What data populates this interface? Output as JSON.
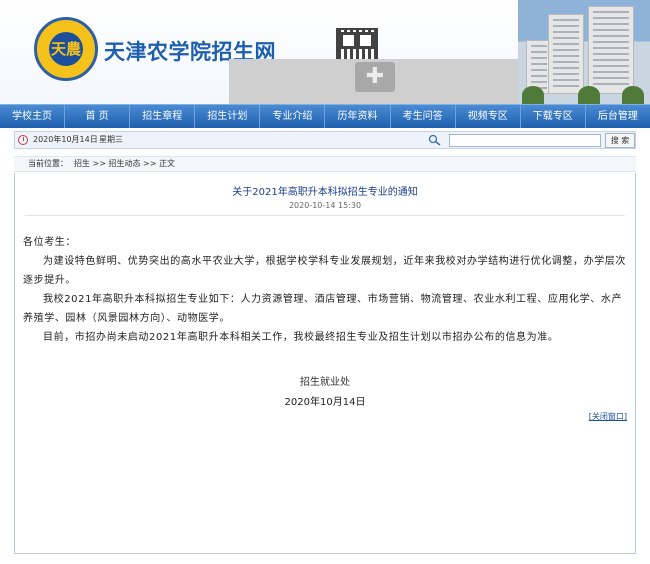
{
  "header": {
    "logo_text": "天農",
    "site_title": "天津农学院招生网"
  },
  "nav": {
    "items": [
      {
        "label": "学校主页"
      },
      {
        "label": "首 页"
      },
      {
        "label": "招生章程"
      },
      {
        "label": "招生计划"
      },
      {
        "label": "专业介绍"
      },
      {
        "label": "历年资料"
      },
      {
        "label": "考生问答"
      },
      {
        "label": "视频专区"
      },
      {
        "label": "下载专区"
      },
      {
        "label": "后台管理"
      }
    ]
  },
  "infobar": {
    "date": "2020年10月14日",
    "weekday": "星期三",
    "search_placeholder": "",
    "search_button": "搜 索"
  },
  "breadcrumb": {
    "prefix": "当前位置：",
    "path": "招生 >> 招生动态 >> 正文"
  },
  "article": {
    "title": "关于2021年高职升本科拟招生专业的通知",
    "time": "2020-10-14 15:30",
    "greeting": "各位考生：",
    "p1": "为建设特色鲜明、优势突出的高水平农业大学，根据学校学科专业发展规划，近年来我校对办学结构进行优化调整，办学层次逐步提升。",
    "p2": "我校2021年高职升本科拟招生专业如下：人力资源管理、酒店管理、市场营销、物流管理、农业水利工程、应用化学、水产养殖学、园林（风景园林方向）、动物医学。",
    "p3": "目前，市招办尚未启动2021年高职升本科相关工作，我校最终招生专业及招生计划以市招办公布的信息为准。",
    "sign": "招生就业处",
    "sign_date": "2020年10月14日",
    "close_label": "[关闭窗口]"
  }
}
